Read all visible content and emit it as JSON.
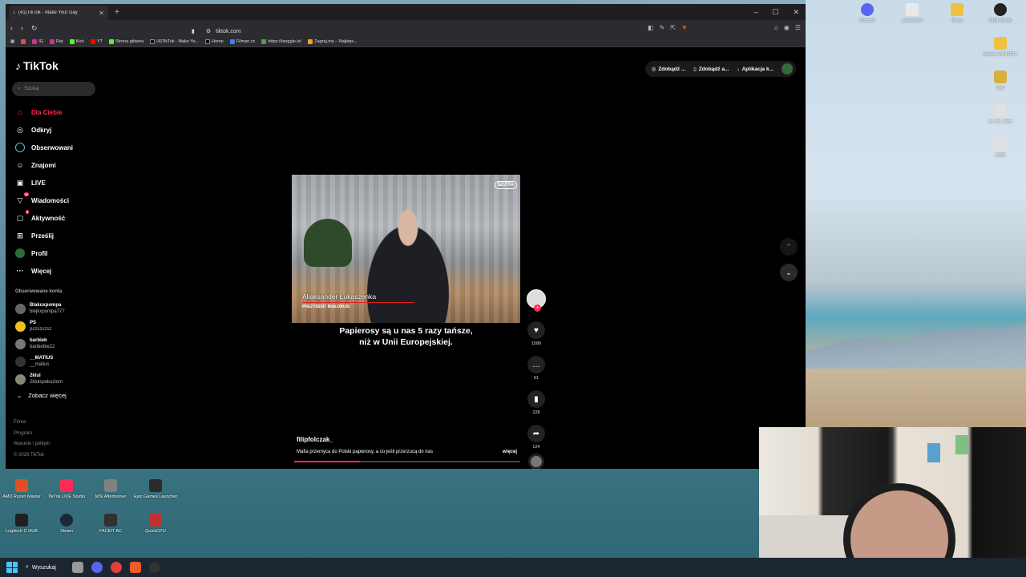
{
  "browser": {
    "tab_title": "(41)TikTok - Make Your Day",
    "url": "tiktok.com",
    "bookmarks": [
      "Rat",
      "IG",
      "Rat",
      "Kick",
      "YT",
      "Strona główna",
      "(4)TikTok - Make Yo...",
      "Home",
      "Filman.cc",
      "https://tanggle.io/",
      "Zagraj.my – Najleps..."
    ]
  },
  "tiktok": {
    "logo": "TikTok",
    "search_placeholder": "Szukaj",
    "nav": [
      {
        "label": "Dla Ciebie",
        "icon": "home-icon"
      },
      {
        "label": "Odkryj",
        "icon": "compass-icon"
      },
      {
        "label": "Obserwowani",
        "icon": "following-icon"
      },
      {
        "label": "Znajomi",
        "icon": "friends-icon"
      },
      {
        "label": "LIVE",
        "icon": "live-icon"
      },
      {
        "label": "Wiadomości",
        "icon": "messages-icon",
        "badge": "32"
      },
      {
        "label": "Aktywność",
        "icon": "activity-icon",
        "badge": "9"
      },
      {
        "label": "Prześlij",
        "icon": "upload-icon"
      },
      {
        "label": "Profil",
        "icon": "profile-icon"
      },
      {
        "label": "Więcej",
        "icon": "more-icon"
      }
    ],
    "followed_title": "Obserwowane konta",
    "followed": [
      {
        "name": "Blakuxpompa",
        "handle": "blejkxpompa777"
      },
      {
        "name": "PS",
        "handle": "pszszszsz"
      },
      {
        "name": "barbieb",
        "handle": "barbiebie22"
      },
      {
        "name": "__MATIUS",
        "handle": "__matius"
      },
      {
        "name": "2klul",
        "handle": "2klulspokoziom"
      }
    ],
    "see_more": "Zobacz więcej",
    "footer": [
      "Firma",
      "Program",
      "Warunki i polityki",
      "© 2026 TikTok"
    ],
    "top_right": [
      "Zdobądź ...",
      "Zdobądź a...",
      "Aplikacja k..."
    ],
    "video": {
      "logo": "БЕЛТА",
      "name_caption": "Aliaksander Łukaszenka",
      "role_caption": "PREZYDENT BIAŁORUSI",
      "subtitle_line1": "Papierosy są u nas 5 razy tańsze,",
      "subtitle_line2": "niż w Unii Europejskiej.",
      "author": "filipfolczak_",
      "description": "Mafia przemyca do Polski papierosy, a co jeśli przerzucą do nas",
      "more": "więcej",
      "progress": 0.29
    },
    "actions": {
      "likes": "1586",
      "comments": "61",
      "saves": "228",
      "shares": "124"
    }
  },
  "desktop_icons": [
    {
      "label": "Discord",
      "color": "#5865f2"
    },
    {
      "label": "ustawienia",
      "color": "#e8e8e8"
    },
    {
      "label": "Nowy",
      "color": "#f0c040"
    },
    {
      "label": "OBS Studio",
      "color": "#222222"
    },
    {
      "label": "modele WHITEX i",
      "color": "#f0c040"
    },
    {
      "label": "stan",
      "color": "#d8b040"
    },
    {
      "label": "nl. sre. ziam",
      "color": "#e0e0e0"
    },
    {
      "label": "2026",
      "color": "#e0e0e0"
    },
    {
      "label": "AMD Ryzen Master",
      "color": "#e05020"
    },
    {
      "label": "TikTok LIVE Studio",
      "color": "#fe2c55"
    },
    {
      "label": "MSI Afterburner",
      "color": "#808080"
    },
    {
      "label": "Epic Games Launcher",
      "color": "#2a2a2a"
    },
    {
      "label": "Logitech G HUB",
      "color": "#202020"
    },
    {
      "label": "Steam",
      "color": "#1b2838"
    },
    {
      "label": "FACEIT AC",
      "color": "#303030"
    },
    {
      "label": "QuickCPU",
      "color": "#c03030"
    }
  ],
  "taskbar": {
    "search": "Wyszukaj"
  }
}
